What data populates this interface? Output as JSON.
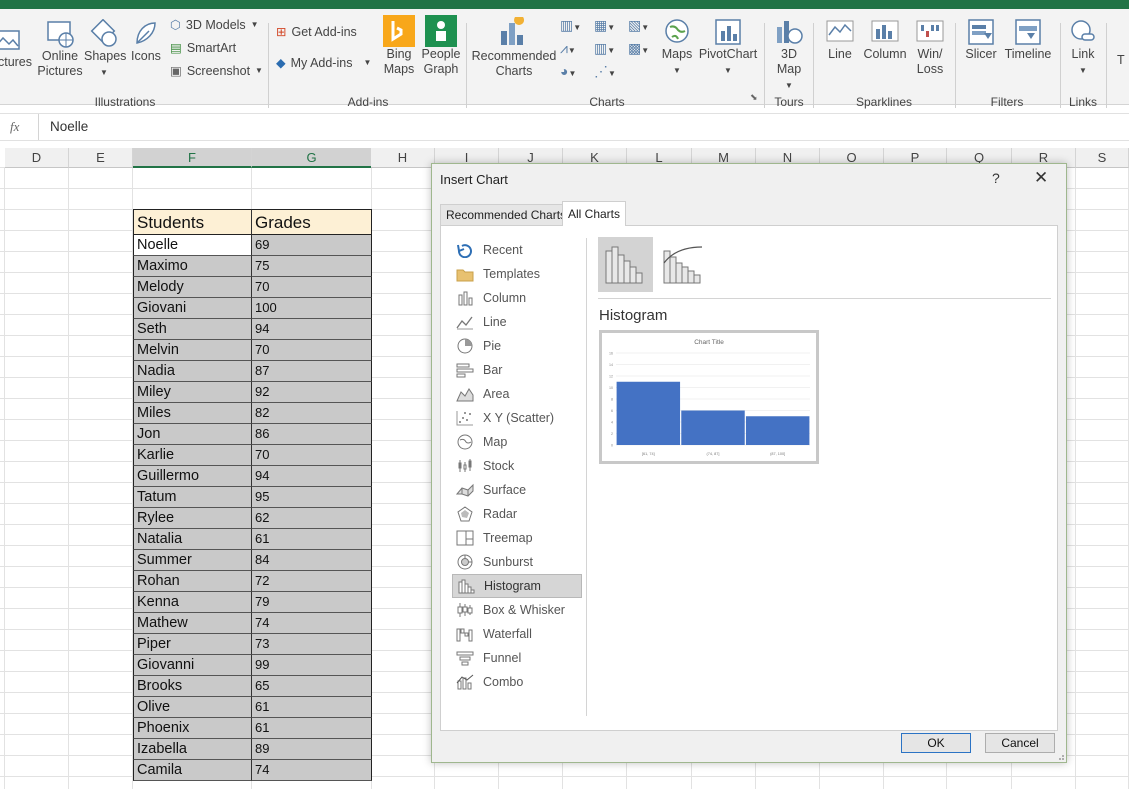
{
  "ribbon": {
    "items": {
      "pictures": "ctures",
      "online_pictures": "Online Pictures",
      "shapes": "Shapes",
      "icons": "Icons",
      "models_3d": "3D Models",
      "smartart": "SmartArt",
      "screenshot": "Screenshot",
      "get_addins": "Get Add-ins",
      "my_addins": "My Add-ins",
      "bing_maps": "Bing Maps",
      "people_graph": "People Graph",
      "recommended_charts": "Recommended Charts",
      "maps": "Maps",
      "pivotchart": "PivotChart",
      "map_3d": "3D Map",
      "line": "Line",
      "column": "Column",
      "winloss": "Win/ Loss",
      "slicer": "Slicer",
      "timeline": "Timeline",
      "link": "Link",
      "text_partial": "T"
    },
    "groups": {
      "illustrations": "Illustrations",
      "addins": "Add-ins",
      "charts": "Charts",
      "tours": "Tours",
      "sparklines": "Sparklines",
      "filters": "Filters",
      "links": "Links"
    }
  },
  "formula_bar": {
    "fx": "fx",
    "value": "Noelle"
  },
  "columns": [
    "D",
    "E",
    "F",
    "G",
    "H",
    "I",
    "J",
    "K",
    "L",
    "M",
    "N",
    "O",
    "P",
    "Q",
    "R",
    "S"
  ],
  "table": {
    "headers": [
      "Students",
      "Grades"
    ],
    "rows": [
      [
        "Noelle",
        "69"
      ],
      [
        "Maximo",
        "75"
      ],
      [
        "Melody",
        "70"
      ],
      [
        "Giovani",
        "100"
      ],
      [
        "Seth",
        "94"
      ],
      [
        "Melvin",
        "70"
      ],
      [
        "Nadia",
        "87"
      ],
      [
        "Miley",
        "92"
      ],
      [
        "Miles",
        "82"
      ],
      [
        "Jon",
        "86"
      ],
      [
        "Karlie",
        "70"
      ],
      [
        "Guillermo",
        "94"
      ],
      [
        "Tatum",
        "95"
      ],
      [
        "Rylee",
        "62"
      ],
      [
        "Natalia",
        "61"
      ],
      [
        "Summer",
        "84"
      ],
      [
        "Rohan",
        "72"
      ],
      [
        "Kenna",
        "79"
      ],
      [
        "Mathew",
        "74"
      ],
      [
        "Piper",
        "73"
      ],
      [
        "Giovanni",
        "99"
      ],
      [
        "Brooks",
        "65"
      ],
      [
        "Olive",
        "61"
      ],
      [
        "Phoenix",
        "61"
      ],
      [
        "Izabella",
        "89"
      ],
      [
        "Camila",
        "74"
      ]
    ]
  },
  "dialog": {
    "title": "Insert Chart",
    "help": "?",
    "close": "✕",
    "tabs": {
      "recommended": "Recommended Charts",
      "all": "All Charts"
    },
    "chart_types": [
      "Recent",
      "Templates",
      "Column",
      "Line",
      "Pie",
      "Bar",
      "Area",
      "X Y (Scatter)",
      "Map",
      "Stock",
      "Surface",
      "Radar",
      "Treemap",
      "Sunburst",
      "Histogram",
      "Box & Whisker",
      "Waterfall",
      "Funnel",
      "Combo"
    ],
    "selected_type": "Histogram",
    "subtype_name": "Histogram",
    "ok": "OK",
    "cancel": "Cancel"
  },
  "chart_data": {
    "type": "bar",
    "title": "Chart Title",
    "categories": [
      "[61, 74]",
      "(74, 87]",
      "(87, 100]"
    ],
    "values": [
      11,
      6,
      5
    ],
    "ylim": [
      0,
      16
    ],
    "yticks": [
      "0",
      "2",
      "4",
      "6",
      "8",
      "10",
      "12",
      "14",
      "16"
    ],
    "color": "#4472c4"
  },
  "colors": {
    "excel_green": "#217346",
    "header_fill": "#fdf0d5",
    "bar": "#4472c4"
  }
}
